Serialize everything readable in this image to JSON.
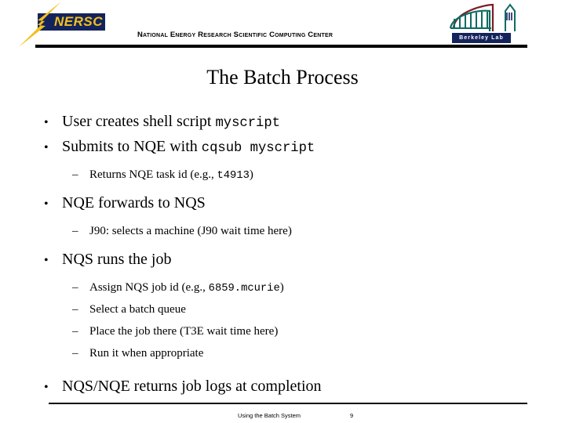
{
  "header": {
    "org_title": "National Energy Research Scientific Computing Center",
    "nersc_logo_word": "NERSC",
    "berkeley_logo_word": "Berkeley Lab"
  },
  "title": "The Batch Process",
  "body": {
    "bullets": [
      {
        "level": 1,
        "marker": "•",
        "parts": [
          {
            "text": "User creates shell script ",
            "mono": false
          },
          {
            "text": "myscript",
            "mono": true
          }
        ]
      },
      {
        "level": 1,
        "marker": "•",
        "parts": [
          {
            "text": "Submits to NQE with ",
            "mono": false
          },
          {
            "text": "cqsub myscript",
            "mono": true
          }
        ]
      },
      {
        "level": 2,
        "marker": "–",
        "parts": [
          {
            "text": "Returns NQE task id (e.g., ",
            "mono": false
          },
          {
            "text": "t4913",
            "mono": true
          },
          {
            "text": ")",
            "mono": false
          }
        ]
      },
      {
        "level": 1,
        "marker": "•",
        "parts": [
          {
            "text": "NQE forwards to NQS",
            "mono": false
          }
        ]
      },
      {
        "level": 2,
        "marker": "–",
        "parts": [
          {
            "text": "J90: selects a machine (J90 wait time here)",
            "mono": false
          }
        ]
      },
      {
        "level": 1,
        "marker": "•",
        "parts": [
          {
            "text": "NQS runs the job",
            "mono": false
          }
        ]
      },
      {
        "level": 2,
        "marker": "–",
        "parts": [
          {
            "text": "Assign NQS job id (e.g., ",
            "mono": false
          },
          {
            "text": "6859.mcurie",
            "mono": true
          },
          {
            "text": ")",
            "mono": false
          }
        ]
      },
      {
        "level": 2,
        "marker": "–",
        "parts": [
          {
            "text": "Select a batch queue",
            "mono": false
          }
        ]
      },
      {
        "level": 2,
        "marker": "–",
        "parts": [
          {
            "text": "Place the job there (T3E wait time here)",
            "mono": false
          }
        ]
      },
      {
        "level": 2,
        "marker": "–",
        "parts": [
          {
            "text": "Run it when appropriate",
            "mono": false
          }
        ]
      },
      {
        "level": 1,
        "marker": "•",
        "parts": [
          {
            "text": "NQS/NQE returns job logs at completion",
            "mono": false
          }
        ]
      }
    ]
  },
  "footer": {
    "label": "Using the Batch System",
    "page_number": "9"
  },
  "colors": {
    "nersc_navy": "#15235c",
    "nersc_gold": "#f2c01c",
    "lbl_dome_red": "#7b1c24",
    "lbl_teal": "#0f6b63",
    "rule_black": "#000000",
    "page_background": "#ffffff"
  }
}
